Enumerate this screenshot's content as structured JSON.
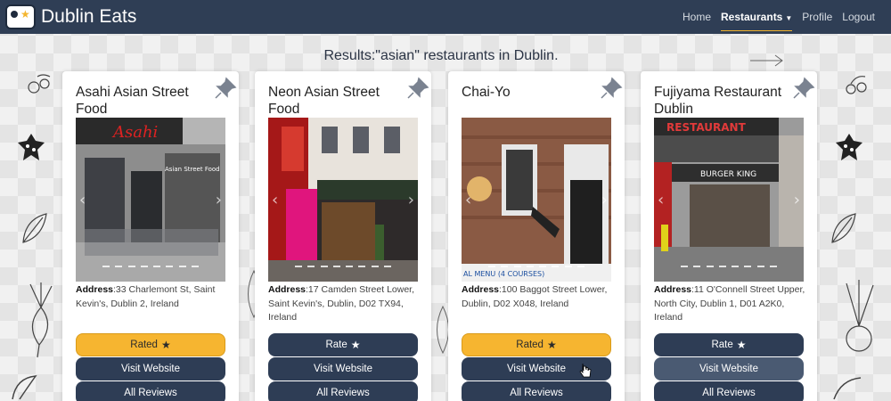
{
  "brand": {
    "name": "Dublin Eats"
  },
  "nav": {
    "home": "Home",
    "restaurants": "Restaurants",
    "profile": "Profile",
    "logout": "Logout"
  },
  "results": {
    "title": "Results:\"asian\" restaurants in Dublin."
  },
  "buttons": {
    "rate": "Rate",
    "rated": "Rated",
    "visit": "Visit Website",
    "reviews": "All Reviews"
  },
  "address_label": "Address",
  "restaurants": [
    {
      "name": "Asahi Asian Street Food",
      "address": ":33 Charlemont St, Saint Kevin's, Dublin 2, Ireland",
      "rated": true
    },
    {
      "name": "Neon Asian Street Food",
      "address": ":17 Camden Street Lower, Saint Kevin's, Dublin, D02 TX94, Ireland",
      "rated": false
    },
    {
      "name": "Chai-Yo",
      "address": ":100 Baggot Street Lower, Dublin, D02 X048, Ireland",
      "rated": true
    },
    {
      "name": "Fujiyama Restaurant Dublin",
      "address": ":11 O'Connell Street Upper, North City, Dublin 1, D01 A2K0, Ireland",
      "rated": false
    }
  ],
  "photo_texts": {
    "asahi_sign": "Asahi",
    "asahi_door": "Asian Street Food",
    "chaiyo_menu": "AL MENU (4 COURSES)",
    "fuji_sign": "RESTAURANT",
    "fuji_store": "BURGER KING"
  },
  "colors": {
    "navbar": "#2f3e55",
    "button": "#2e3d55",
    "accent": "#f6b530"
  }
}
